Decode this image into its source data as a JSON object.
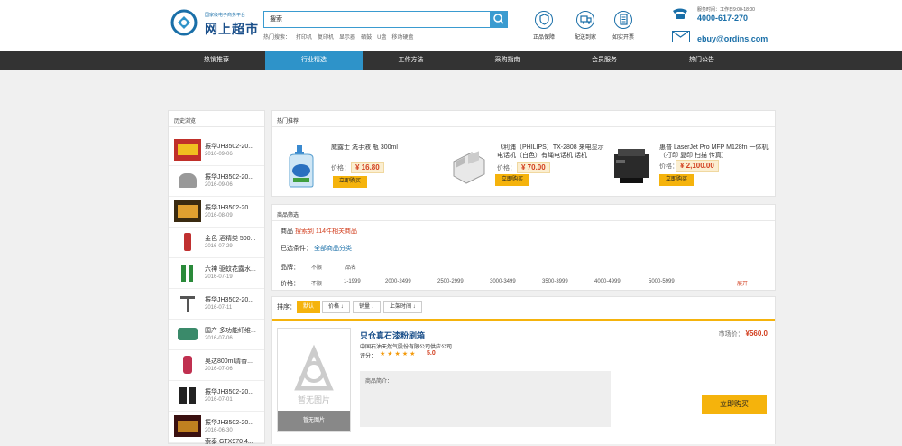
{
  "header": {
    "logo_small": "国家级电子商务平台",
    "logo_big": "网上超市",
    "search_value": "搜索",
    "hot_words": [
      "热门搜索：",
      "打印机",
      "复印机",
      "显示器",
      "硒鼓",
      "U盘",
      "移动硬盘"
    ],
    "features": [
      {
        "label": "正品保障",
        "icon": "shield-icon"
      },
      {
        "label": "配送到家",
        "icon": "truck-icon"
      },
      {
        "label": "如实开票",
        "icon": "invoice-icon"
      }
    ],
    "contact": {
      "time": "服务时间：工作日9:00-18:00",
      "phone": "4000-617-270",
      "email": "ebuy@ordins.com"
    }
  },
  "nav": {
    "items": [
      {
        "label": "热销推荐",
        "active": false
      },
      {
        "label": "行业精选",
        "active": true
      },
      {
        "label": "工作方法",
        "active": false
      },
      {
        "label": "采购指南",
        "active": false
      },
      {
        "label": "会员服务",
        "active": false
      },
      {
        "label": "热门公告",
        "active": false
      }
    ]
  },
  "history": {
    "title": "历史浏览",
    "items": [
      {
        "name": "振华JH3502-20...",
        "date": "2016-09-06"
      },
      {
        "name": "振华JH3502-20...",
        "date": "2016-09-06"
      },
      {
        "name": "振华JH3502-20...",
        "date": "2016-08-09"
      },
      {
        "name": "金色 酒精类 500...",
        "date": "2016-07-29"
      },
      {
        "name": "六神 驱蚊花露水...",
        "date": "2016-07-19"
      },
      {
        "name": "振华JH3502-20...",
        "date": "2016-07-11"
      },
      {
        "name": "国产 多功能纤维...",
        "date": "2016-07-06"
      },
      {
        "name": "奥达800ml清香...",
        "date": "2016-07-06"
      },
      {
        "name": "振华JH3502-20...",
        "date": "2016-07-01"
      },
      {
        "name": "振华JH3502-20...",
        "date": "2016-06-30"
      },
      {
        "name": "索泰 GTX970 4...",
        "date": ""
      }
    ]
  },
  "hot_products": {
    "title": "热门推荐",
    "price_label": "价格：",
    "buy_label": "立即购买",
    "items": [
      {
        "name": "威露士 洗手液 瓶 300ml",
        "price": "¥ 16.80"
      },
      {
        "name": "飞利浦（PHILIPS）TX-2808 来电显示电话机（白色）有绳电话机 话机",
        "price": "¥ 70.00"
      },
      {
        "name": "惠普 LaserJet Pro MFP M128fn 一体机（打印 复印 扫描 传真）",
        "price": "¥ 2,100.00"
      }
    ]
  },
  "filter": {
    "title": "商品筛选",
    "summary_label": "商品",
    "summary_text": "搜索到 114件相关商品",
    "selected_label": "已选条件：",
    "selected_value": "全部商品分类",
    "rows": [
      {
        "label": "品牌：",
        "options": [
          "不限",
          "品名"
        ]
      },
      {
        "label": "价格：",
        "options": [
          "不限",
          "1-1999",
          "2000-2499",
          "2500-2999",
          "3000-3499",
          "3500-3999",
          "4000-4999",
          "5000-5999"
        ]
      }
    ],
    "expand_label": "展开"
  },
  "sort": {
    "label": "排序：",
    "buttons": [
      "默认",
      "价格 ↓",
      "销量 ↓",
      "上架时间 ↓"
    ]
  },
  "product": {
    "image_caption": "暂无图片",
    "title": "只仓真石漆粉刷箱",
    "company": "中国石油天然气股份有限公司供应公司",
    "rating_label": "评分：",
    "stars": "★★★★★",
    "score": "5.0",
    "desc_label": "商品简介：",
    "market_label": "市场价：",
    "market_price": "¥560.0",
    "buy_label": "立即购买"
  },
  "colors": {
    "accent_blue": "#2e93c9",
    "accent_yellow": "#f5b30c",
    "price_red": "#d23f1f"
  }
}
